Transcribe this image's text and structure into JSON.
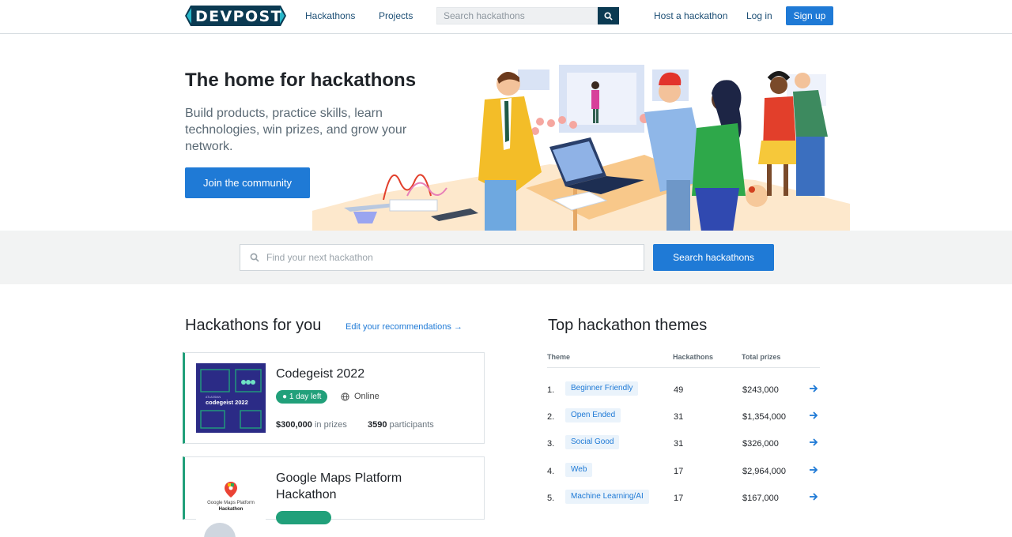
{
  "header": {
    "logo": "DEVPOST",
    "nav": {
      "hackathons": "Hackathons",
      "projects": "Projects"
    },
    "search_placeholder": "Search hackathons",
    "host": "Host a hackathon",
    "login": "Log in",
    "signup": "Sign up"
  },
  "hero": {
    "title": "The home for hackathons",
    "subtitle": "Build products, practice skills, learn technologies, win prizes, and grow your network.",
    "cta": "Join the community"
  },
  "search_band": {
    "placeholder": "Find your next hackathon",
    "button": "Search hackathons"
  },
  "for_you": {
    "title": "Hackathons for you",
    "edit": "Edit your recommendations",
    "cards": [
      {
        "title": "Codegeist 2022",
        "badge": "1 day left",
        "location": "Online",
        "prize_amount": "$300,000",
        "prize_suffix": "in prizes",
        "participants_count": "3590",
        "participants_suffix": "participants",
        "thumb_label_small": "ATLASSIAN",
        "thumb_label": "codegeist 2022"
      },
      {
        "title": "Google Maps Platform Hackathon",
        "thumb_label": "Google Maps Platform",
        "thumb_label2": "Hackathon"
      }
    ]
  },
  "themes": {
    "title": "Top hackathon themes",
    "columns": {
      "theme": "Theme",
      "hackathons": "Hackathons",
      "prizes": "Total prizes"
    },
    "rows": [
      {
        "rank": "1.",
        "name": "Beginner Friendly",
        "count": "49",
        "prize": "$243,000"
      },
      {
        "rank": "2.",
        "name": "Open Ended",
        "count": "31",
        "prize": "$1,354,000"
      },
      {
        "rank": "3.",
        "name": "Social Good",
        "count": "31",
        "prize": "$326,000"
      },
      {
        "rank": "4.",
        "name": "Web",
        "count": "17",
        "prize": "$2,964,000"
      },
      {
        "rank": "5.",
        "name": "Machine Learning/AI",
        "count": "17",
        "prize": "$167,000"
      }
    ]
  },
  "colors": {
    "brand_navy": "#0b3a52",
    "accent_blue": "#1f7ad6",
    "teal": "#21a07a"
  }
}
